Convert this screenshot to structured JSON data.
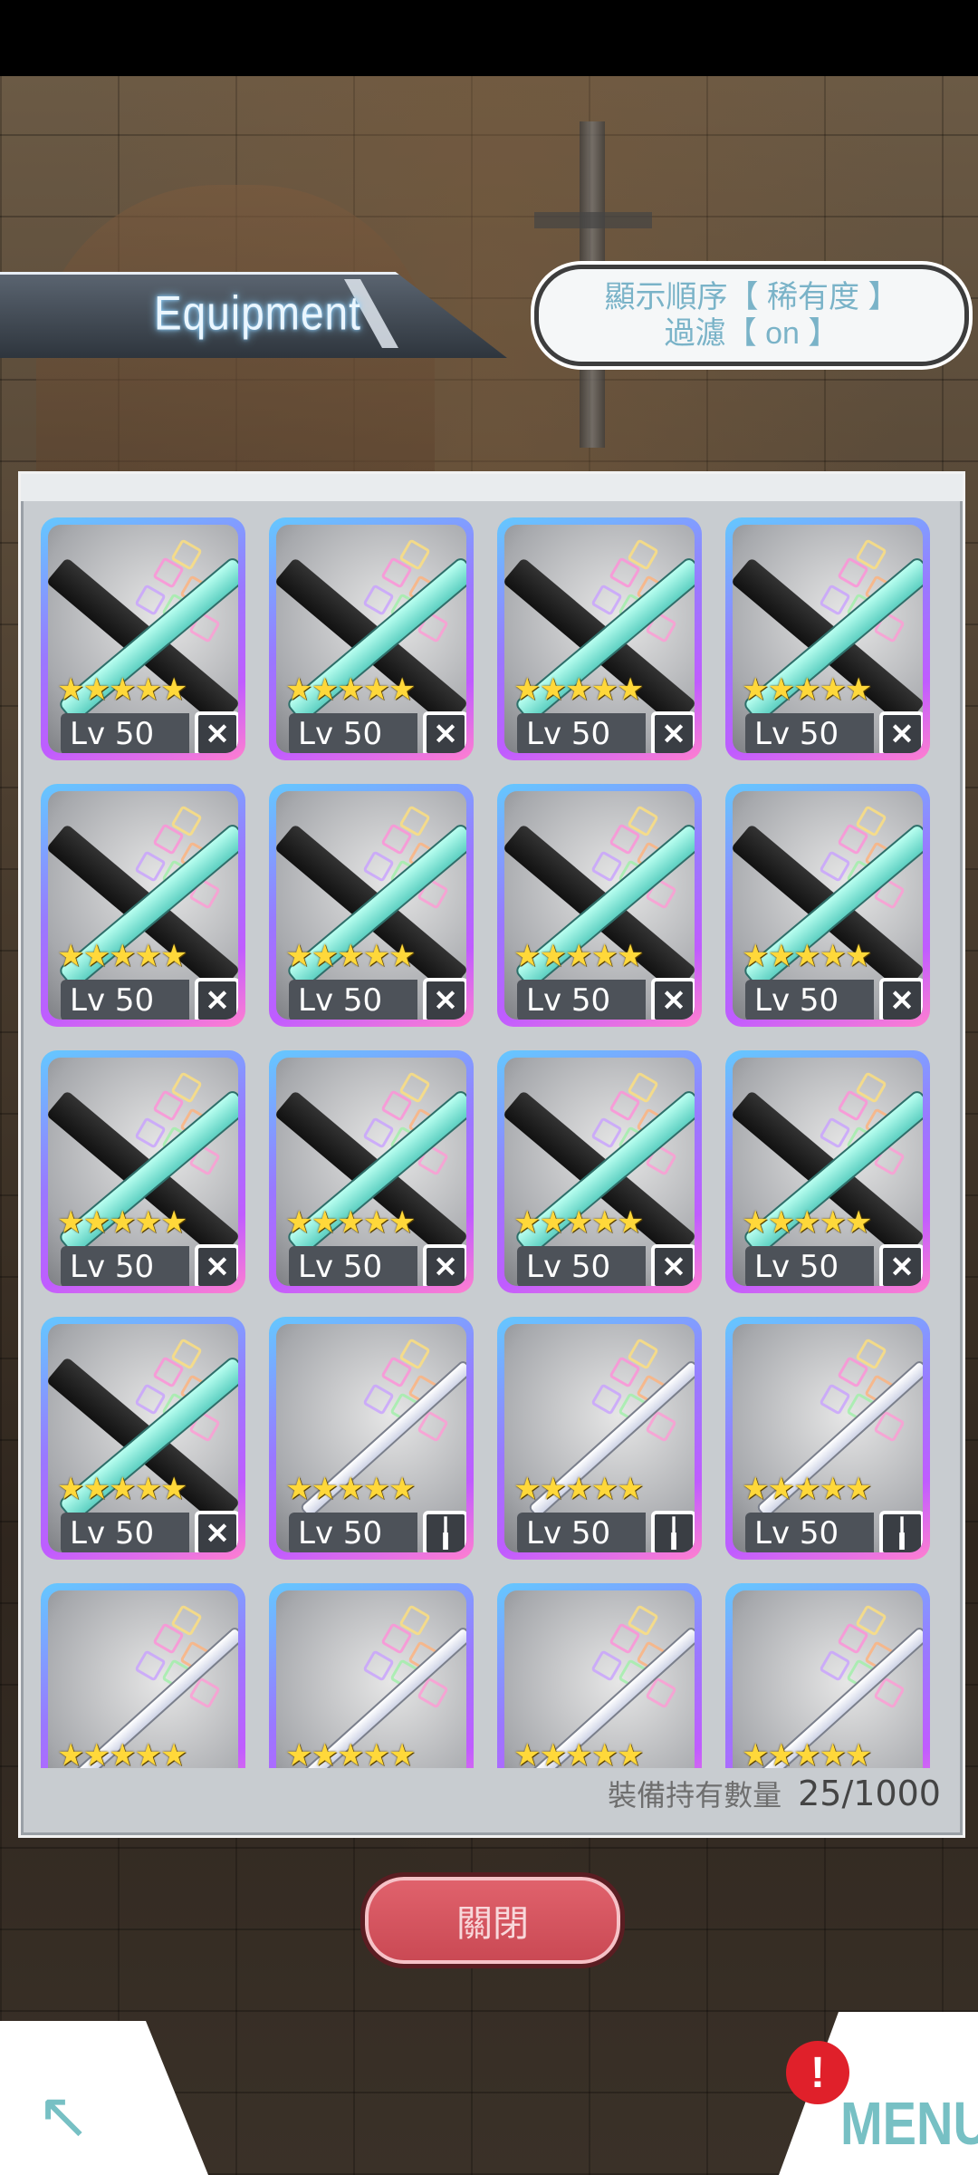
{
  "header": {
    "title": "Equipment",
    "sort_line1": "顯示順序【 稀有度 】",
    "sort_line2": "過濾【 on 】"
  },
  "inventory": {
    "items": [
      {
        "level_label": "Lv 50",
        "stars": "★★★★★",
        "weapon": "dark-teal-twin-swords",
        "type_icon": "crossed-swords-icon"
      },
      {
        "level_label": "Lv 50",
        "stars": "★★★★★",
        "weapon": "dark-teal-twin-swords",
        "type_icon": "crossed-swords-icon"
      },
      {
        "level_label": "Lv 50",
        "stars": "★★★★★",
        "weapon": "dark-teal-twin-swords",
        "type_icon": "crossed-swords-icon"
      },
      {
        "level_label": "Lv 50",
        "stars": "★★★★★",
        "weapon": "dark-teal-twin-swords",
        "type_icon": "crossed-swords-icon"
      },
      {
        "level_label": "Lv 50",
        "stars": "★★★★★",
        "weapon": "dark-teal-twin-swords",
        "type_icon": "crossed-swords-icon"
      },
      {
        "level_label": "Lv 50",
        "stars": "★★★★★",
        "weapon": "dark-teal-twin-swords",
        "type_icon": "crossed-swords-icon"
      },
      {
        "level_label": "Lv 50",
        "stars": "★★★★★",
        "weapon": "dark-teal-twin-swords",
        "type_icon": "crossed-swords-icon"
      },
      {
        "level_label": "Lv 50",
        "stars": "★★★★★",
        "weapon": "dark-teal-twin-swords",
        "type_icon": "crossed-swords-icon"
      },
      {
        "level_label": "Lv 50",
        "stars": "★★★★★",
        "weapon": "dark-teal-twin-swords",
        "type_icon": "crossed-swords-icon"
      },
      {
        "level_label": "Lv 50",
        "stars": "★★★★★",
        "weapon": "dark-teal-twin-swords",
        "type_icon": "crossed-swords-icon"
      },
      {
        "level_label": "Lv 50",
        "stars": "★★★★★",
        "weapon": "dark-teal-twin-swords",
        "type_icon": "crossed-swords-icon"
      },
      {
        "level_label": "Lv 50",
        "stars": "★★★★★",
        "weapon": "dark-teal-twin-swords",
        "type_icon": "crossed-swords-icon"
      },
      {
        "level_label": "Lv 50",
        "stars": "★★★★★",
        "weapon": "dark-teal-twin-swords",
        "type_icon": "crossed-swords-icon"
      },
      {
        "level_label": "Lv 50",
        "stars": "★★★★★",
        "weapon": "white-rapier",
        "type_icon": "rapier-icon"
      },
      {
        "level_label": "Lv 50",
        "stars": "★★★★★",
        "weapon": "white-rapier",
        "type_icon": "rapier-icon"
      },
      {
        "level_label": "Lv 50",
        "stars": "★★★★★",
        "weapon": "white-rapier",
        "type_icon": "rapier-icon"
      },
      {
        "level_label": "",
        "stars": "★★★★★",
        "weapon": "white-rapier",
        "type_icon": ""
      },
      {
        "level_label": "",
        "stars": "★★★★★",
        "weapon": "white-rapier",
        "type_icon": ""
      },
      {
        "level_label": "",
        "stars": "★★★★★",
        "weapon": "white-rapier",
        "type_icon": ""
      },
      {
        "level_label": "",
        "stars": "★★★★★",
        "weapon": "white-rapier",
        "type_icon": ""
      }
    ],
    "count_label": "裝備持有數量",
    "count_value": "25/1000"
  },
  "footer": {
    "close_label": "關閉",
    "menu_label": "MENU",
    "alert_mark": "!",
    "back_icon": "back-arrow-icon"
  },
  "colors": {
    "card_frame_blue": "#64c8ff",
    "card_frame_purple": "#c05cff",
    "star_gold": "#ffd83a",
    "close_red": "#d9535e",
    "menu_teal": "#77c0c4",
    "title_glow": "#8fd2ff"
  }
}
